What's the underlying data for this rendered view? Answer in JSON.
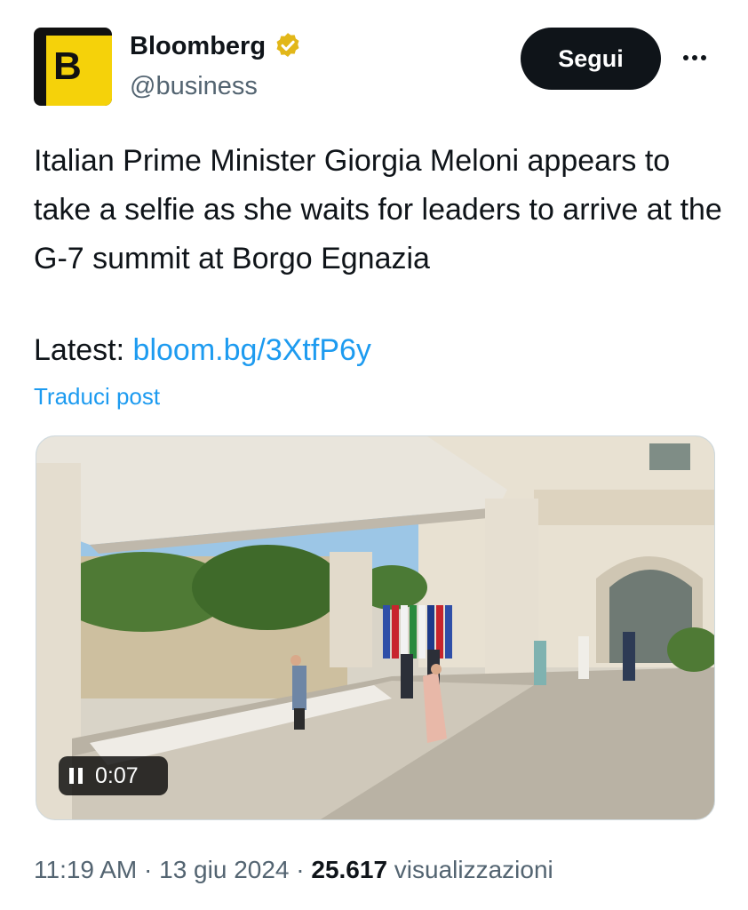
{
  "author": {
    "display_name": "Bloomberg",
    "handle": "@business",
    "avatar_letter": "B",
    "avatar_color": "#f5d20a",
    "verified_icon": "gold-verified-badge-icon",
    "verified_color": "#e2b719"
  },
  "actions": {
    "follow_label": "Segui",
    "more_icon": "more-dots-icon"
  },
  "tweet": {
    "text": "Italian Prime Minister Giorgia Meloni appears to take a selfie as she waits for leaders to arrive at the G-7 summit at Borgo Egnazia",
    "latest_label": "Latest:",
    "link_text": "bloom.bg/3XtfP6y",
    "translate_label": "Traduci post"
  },
  "media": {
    "type": "video",
    "time": "0:07",
    "control_icon": "pause-icon"
  },
  "meta": {
    "time": "11:19 AM",
    "separator": "·",
    "date": "13 giu 2024",
    "views_count": "25.617",
    "views_label": "visualizzazioni"
  },
  "colors": {
    "link": "#1d9bf0",
    "follow_bg": "#0f1419",
    "secondary_text": "#536471"
  }
}
